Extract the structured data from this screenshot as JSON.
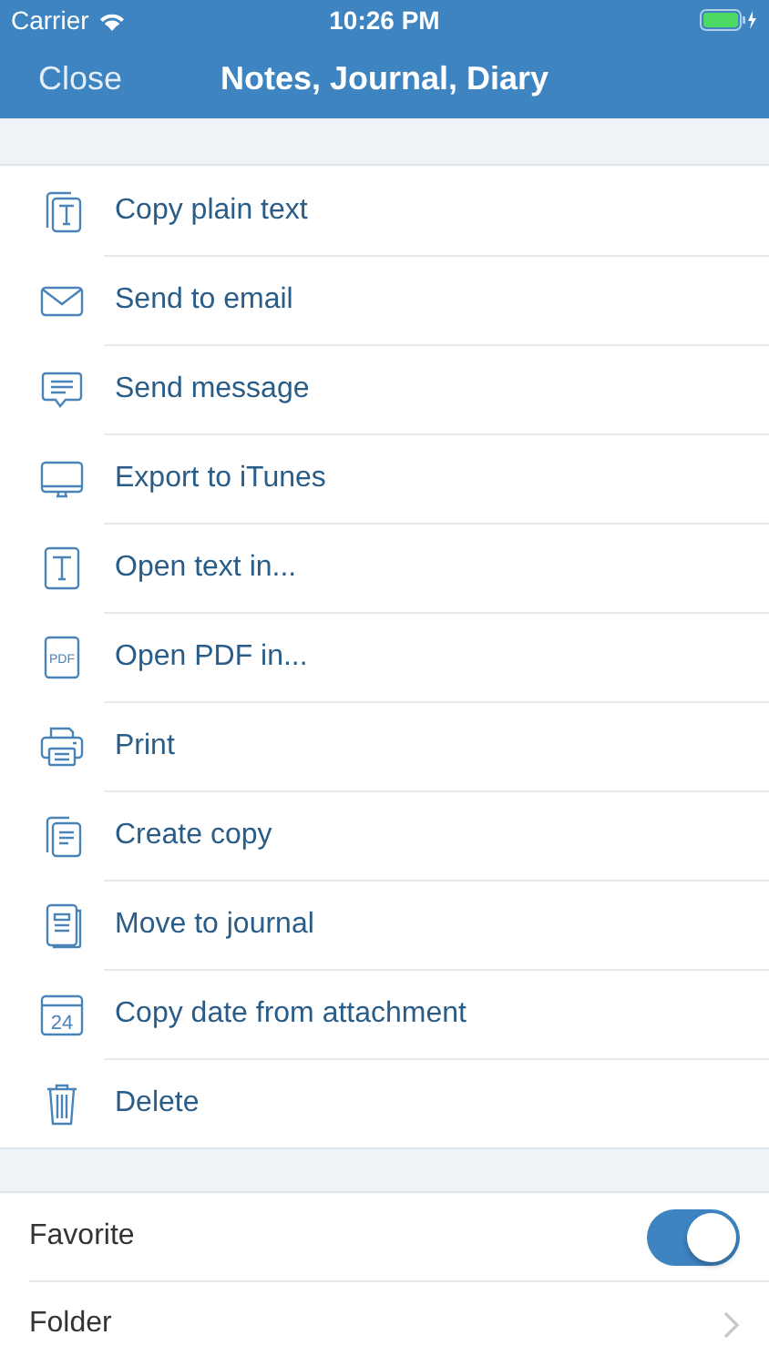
{
  "status_bar": {
    "carrier": "Carrier",
    "time": "10:26 PM"
  },
  "nav_bar": {
    "back": "Close",
    "title": "Notes, Journal, Diary"
  },
  "actions": [
    {
      "kind": "copy-text",
      "label": "Copy plain text"
    },
    {
      "kind": "email",
      "label": "Send to email"
    },
    {
      "kind": "message",
      "label": "Send message"
    },
    {
      "kind": "monitor",
      "label": "Export to iTunes"
    },
    {
      "kind": "text",
      "label": "Open text in..."
    },
    {
      "kind": "pdf",
      "label": "Open PDF in...",
      "icon_text": "PDF"
    },
    {
      "kind": "print",
      "label": "Print"
    },
    {
      "kind": "copy",
      "label": "Create copy"
    },
    {
      "kind": "journal",
      "label": "Move to journal"
    },
    {
      "kind": "calendar",
      "label": "Copy date from attachment",
      "icon_text": "24"
    },
    {
      "kind": "trash",
      "label": "Delete"
    }
  ],
  "settings": [
    {
      "kind": "toggle",
      "label": "Favorite",
      "on": true
    },
    {
      "kind": "link",
      "label": "Folder"
    }
  ]
}
